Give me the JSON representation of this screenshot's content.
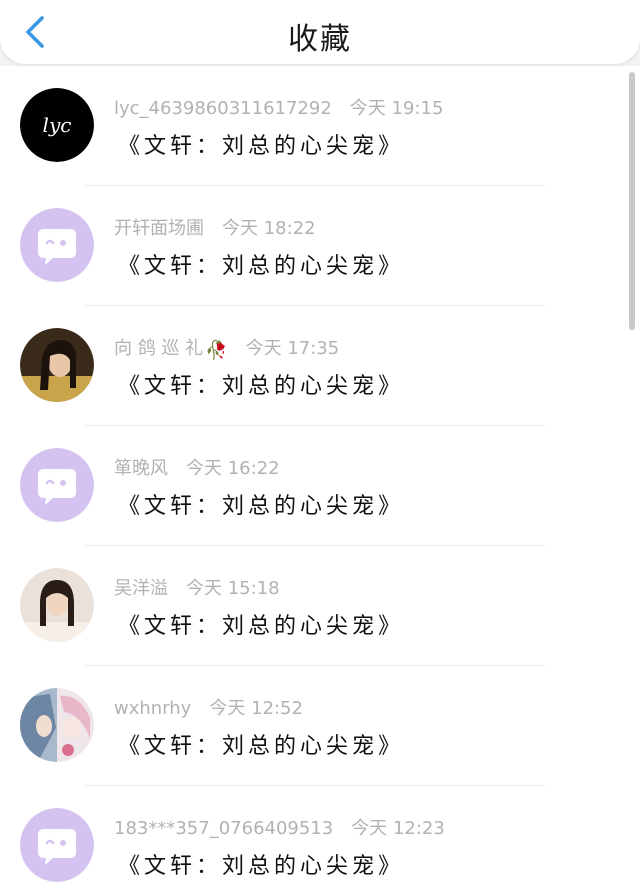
{
  "header": {
    "title": "收藏",
    "back_icon": "chevron-left-icon",
    "accent_color": "#3a96e6"
  },
  "rows": [
    {
      "name": "lyc_4639860311617292",
      "time": "今天 19:15",
      "message": "《文轩：刘总的心尖宠》",
      "avatar": "lyc-logo-avatar"
    },
    {
      "name": "开轩面场圃",
      "time": "今天 18:22",
      "message": "《文轩：刘总的心尖宠》",
      "avatar": "default-chat-avatar"
    },
    {
      "name": "向 鸽 巡 礼",
      "name_emoji": "🥀",
      "time": "今天 17:35",
      "message": "《文轩：刘总的心尖宠》",
      "avatar": "photo-avatar-girl-dark"
    },
    {
      "name": "箪晚风",
      "time": "今天 16:22",
      "message": "《文轩：刘总的心尖宠》",
      "avatar": "default-chat-avatar"
    },
    {
      "name": "吴洋溢",
      "time": "今天 15:18",
      "message": "《文轩：刘总的心尖宠》",
      "avatar": "photo-avatar-girl-light"
    },
    {
      "name": "wxhnrhy",
      "time": "今天 12:52",
      "message": "《文轩：刘总的心尖宠》",
      "avatar": "anime-avatar"
    },
    {
      "name": "183***357_0766409513",
      "time": "今天 12:23",
      "message": "《文轩：刘总的心尖宠》",
      "avatar": "default-chat-avatar"
    }
  ],
  "colors": {
    "default_avatar_bg": "#d4c3f0",
    "meta_text": "#b2b2b2",
    "message_text": "#111111"
  }
}
